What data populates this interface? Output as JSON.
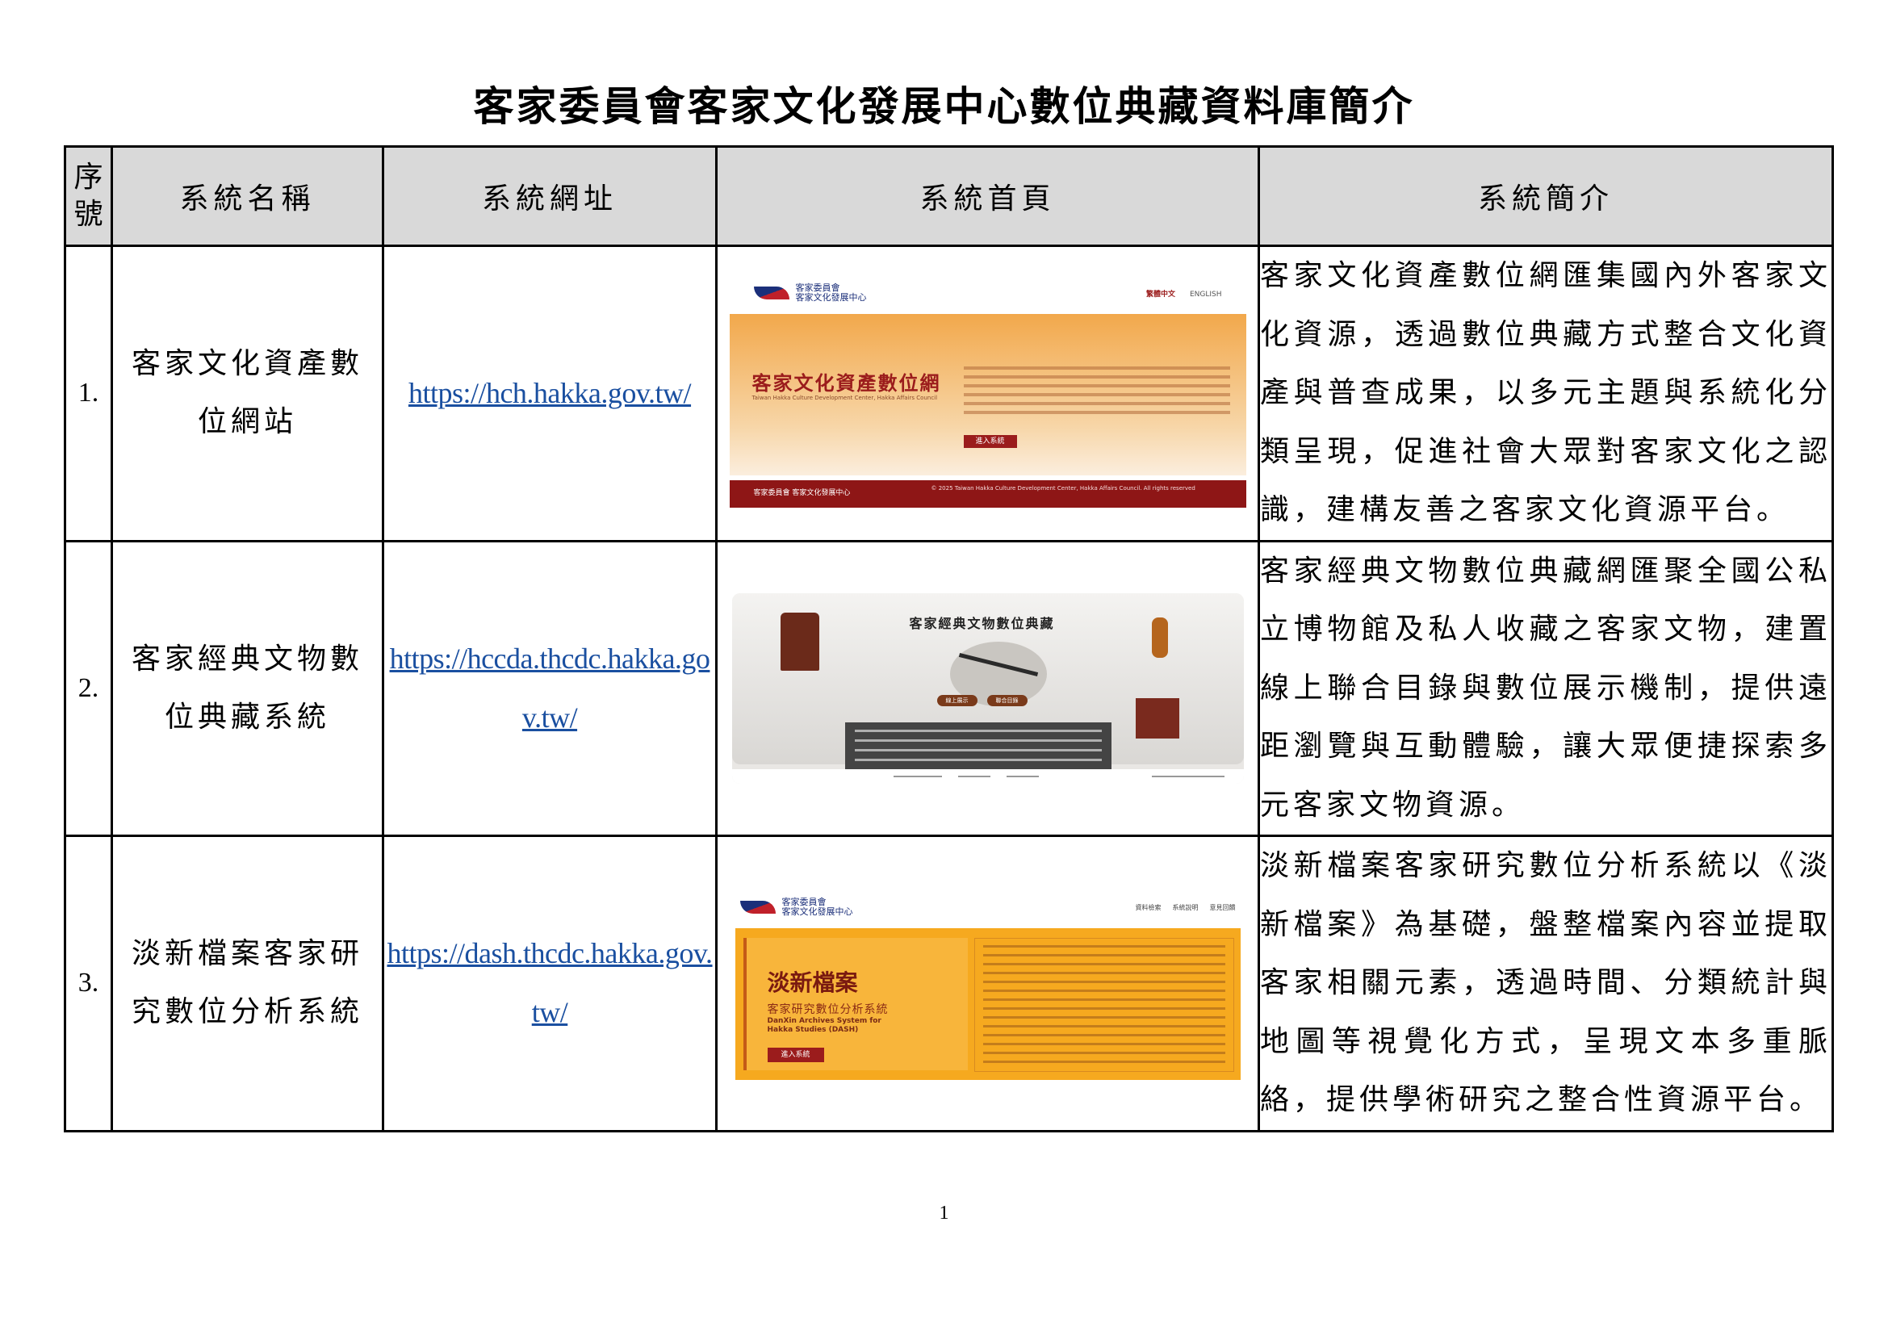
{
  "title": "客家委員會客家文化發展中心數位典藏資料庫簡介",
  "headers": {
    "seq_line1": "序",
    "seq_line2": "號",
    "name": "系統名稱",
    "url": "系統網址",
    "homepage": "系統首頁",
    "intro": "系統簡介"
  },
  "rows": [
    {
      "seq": "1.",
      "name_line1": "客家文化資產數",
      "name_line2": "位網站",
      "url": "https://hch.hakka.gov.tw/",
      "intro": "客家文化資產數位網匯集國內外客家文化資源，透過數位典藏方式整合文化資產與普查成果，以多元主題與系統化分類呈現，促進社會大眾對客家文化之認識，建構友善之客家文化資源平台。",
      "thumb": {
        "logo_line1": "客家委員會",
        "logo_line2": "客家文化發展中心",
        "lang_active": "繁體中文",
        "lang_other": "ENGLISH",
        "heading": "客家文化資產數位網",
        "heading_sub": "Taiwan Hakka Culture Development Center, Hakka Affairs Council",
        "button": "進入系統",
        "footer_left": "客家委員會 客家文化發展中心",
        "footer_right": "© 2025 Taiwan Hakka Culture Development Center, Hakka Affairs Council. All rights reserved"
      }
    },
    {
      "seq": "2.",
      "name_line1": "客家經典文物數",
      "name_line2": "位典藏系統",
      "url": "https://hccda.thcdc.hakka.gov.tw/",
      "intro": "客家經典文物數位典藏網匯聚全國公私立博物館及私人收藏之客家文物，建置線上聯合目錄與數位展示機制，提供遠距瀏覽與互動體驗，讓大眾便捷探索多元客家文物資源。",
      "thumb": {
        "heading": "客家經典文物數位典藏",
        "button1": "線上展示",
        "button2": "聯合目錄"
      }
    },
    {
      "seq": "3.",
      "name_line1": "淡新檔案客家研",
      "name_line2": "究數位分析系統",
      "url": "https://dash.thcdc.hakka.gov.tw/",
      "intro": "淡新檔案客家研究數位分析系統以《淡新檔案》為基礎，盤整檔案內容並提取客家相關元素，透過時間、分類統計與地圖等視覺化方式，呈現文本多重脈絡，提供學術研究之整合性資源平台。",
      "thumb": {
        "logo_line1": "客家委員會",
        "logo_line2": "客家文化發展中心",
        "nav": [
          "資料檢索",
          "系統說明",
          "意見回饋"
        ],
        "heading": "淡新檔案",
        "heading_sub": "客家研究數位分析系統",
        "heading_en_line1": "DanXin Archives System for",
        "heading_en_line2": "Hakka Studies (DASH)",
        "button": "進入系統"
      }
    }
  ],
  "page_number": "1"
}
